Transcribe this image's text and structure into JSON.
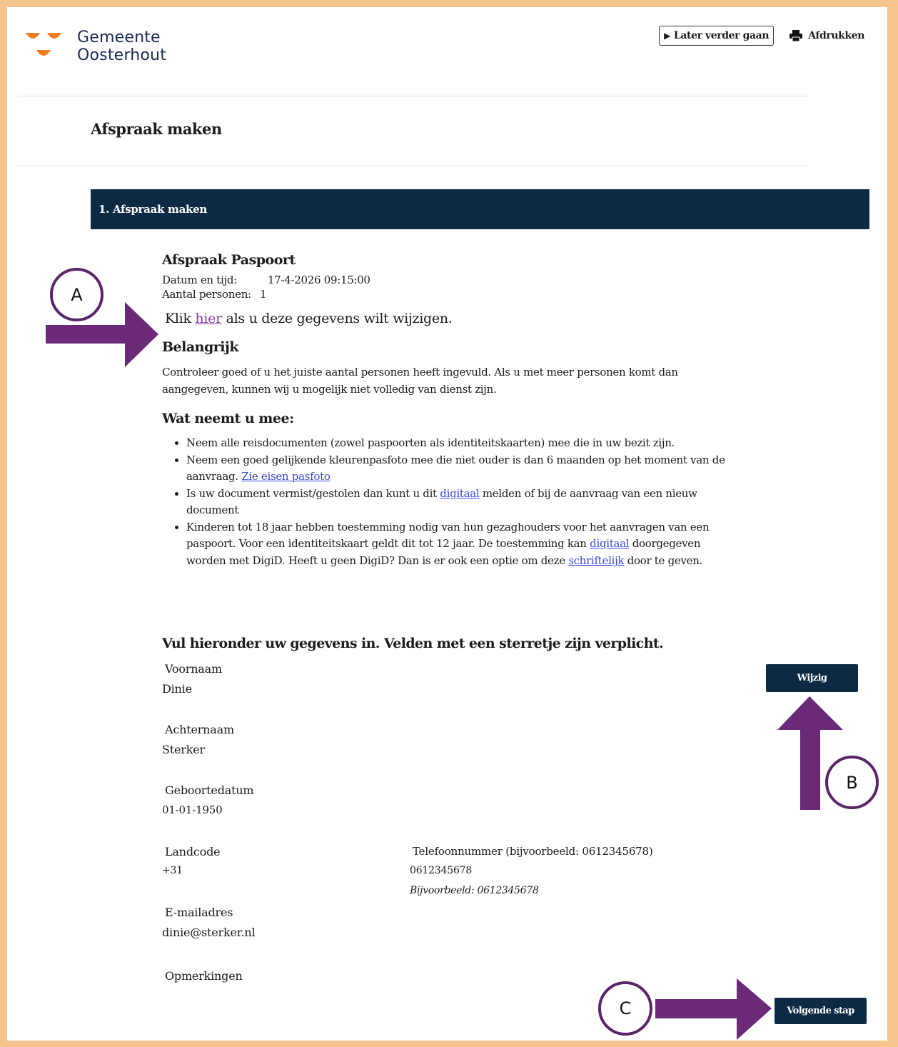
{
  "header": {
    "logo_line1": "Gemeente",
    "logo_line2": "Oosterhout",
    "later_button": "Later verder gaan",
    "print_label": "Afdrukken"
  },
  "page_title": "Afspraak maken",
  "step_bar": "1. Afspraak maken",
  "appointment": {
    "heading": "Afspraak Paspoort",
    "datetime_label": "Datum en tijd:",
    "datetime_value": "17-4-2026 09:15:00",
    "persons_label": "Aantal personen:",
    "persons_value": "1",
    "klik_prefix": "Klik",
    "klik_link": "hier",
    "klik_suffix": "als u deze gegevens wilt wijzigen."
  },
  "important": {
    "heading": "Belangrijk",
    "text": "Controleer goed of u het juiste aantal personen heeft ingevuld. Als u met meer personen komt dan aangegeven, kunnen wij u mogelijk niet volledig van dienst zijn."
  },
  "bring": {
    "heading": "Wat neemt u mee:",
    "item1": "Neem alle reisdocumenten (zowel paspoorten als identiteitskaarten) mee die in uw bezit zijn.",
    "item2_text": "Neem een goed gelijkende kleurenpasfoto mee die niet ouder is dan 6 maanden op het moment van de aanvraag.",
    "item2_link": "Zie eisen pasfoto",
    "item3_prefix": "Is uw document vermist/gestolen dan kunt u dit",
    "item3_link": "digitaal",
    "item3_suffix": "melden of bij de aanvraag van een nieuw document",
    "item4_prefix": "Kinderen tot 18 jaar hebben toestemming nodig van hun gezaghouders voor het aanvragen van een paspoort. Voor een identiteitskaart geldt dit tot 12 jaar. De toestemming kan",
    "item4_link1": "digitaal",
    "item4_mid": "doorgegeven worden met DigiD. Heeft u geen DigiD? Dan is er ook een optie om deze",
    "item4_link2": "schriftelijk",
    "item4_suffix": "door te geven."
  },
  "form": {
    "title": "Vul hieronder uw gegevens in. Velden met een sterretje zijn verplicht.",
    "voornaam_label": "Voornaam",
    "voornaam_value": "Dinie",
    "achternaam_label": "Achternaam",
    "achternaam_value": "Sterker",
    "geboortedatum_label": "Geboortedatum",
    "geboortedatum_value": "01-01-1950",
    "landcode_label": "Landcode",
    "landcode_value": "+31",
    "telefoon_label": "Telefoonnummer (bijvoorbeeld: 0612345678)",
    "telefoon_value": "0612345678",
    "telefoon_hint": "Bijvoorbeeld: 0612345678",
    "email_label": "E-mailadres",
    "email_value": "dinie@sterker.nl",
    "opmerkingen_label": "Opmerkingen",
    "wijzig_button": "Wijzig",
    "next_button": "Volgende stap"
  },
  "annotations": {
    "a": "A",
    "b": "B",
    "c": "C",
    "color": "#6a2a78"
  },
  "colors": {
    "frame": "#f6c48e",
    "navy": "#0c2a44",
    "logo_orange": "#f07d1e",
    "logo_text": "#1b2b52"
  }
}
